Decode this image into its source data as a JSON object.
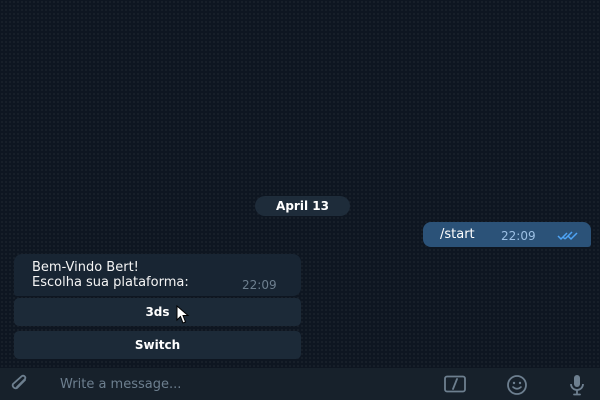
{
  "chat": {
    "date_label": "April 13",
    "outgoing": {
      "text": "/start",
      "time": "22:09",
      "status_icon": "double-check-icon"
    },
    "incoming": {
      "line1": "Bem-Vindo Bert!",
      "line2": "Escolha sua plataforma:",
      "time": "22:09"
    },
    "keyboard": [
      {
        "label": "3ds"
      },
      {
        "label": "Switch"
      }
    ]
  },
  "composer": {
    "placeholder": "Write a message...",
    "icons": [
      "paperclip-icon",
      "commands-icon",
      "emoji-icon",
      "microphone-icon"
    ]
  },
  "colors": {
    "background": "#0e1621",
    "outgoing_bubble": "#2b5278",
    "incoming_bubble": "#182533",
    "accent": "#4ea4f6"
  }
}
